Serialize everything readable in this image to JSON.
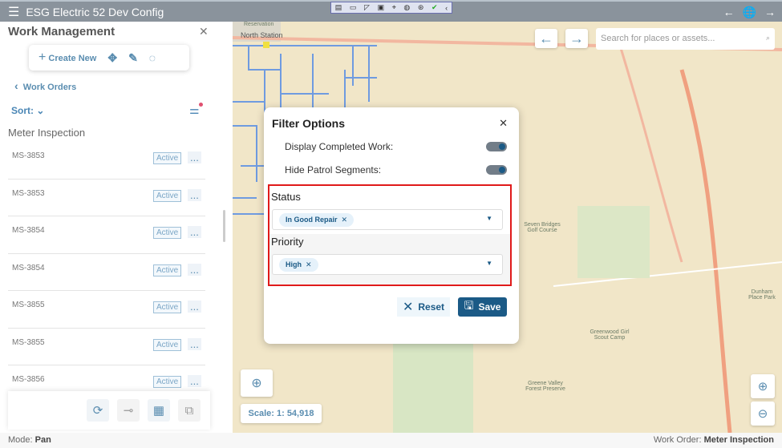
{
  "app": {
    "title": "ESG Electric 52 Dev Config",
    "menu_icon": "hamburger-icon"
  },
  "toolstrip": {
    "icons": [
      "clip-icon",
      "video-icon",
      "pointer-icon",
      "square-icon",
      "cursor-icon",
      "mic-icon",
      "accessibility-icon",
      "check-icon",
      "chevron-left-icon"
    ]
  },
  "sidebar": {
    "title": "Work Management",
    "create_new": "Create New",
    "back_label": "Work Orders",
    "sort_label": "Sort:",
    "section": "Meter Inspection",
    "items": [
      {
        "id": "MS-3853",
        "status": "Active"
      },
      {
        "id": "MS-3853",
        "status": "Active"
      },
      {
        "id": "MS-3854",
        "status": "Active"
      },
      {
        "id": "MS-3854",
        "status": "Active"
      },
      {
        "id": "MS-3855",
        "status": "Active"
      },
      {
        "id": "MS-3855",
        "status": "Active"
      },
      {
        "id": "MS-3856",
        "status": "Active"
      }
    ],
    "more": "..."
  },
  "map": {
    "search_placeholder": "Search for places or assets...",
    "scale": "Scale: 1: 54,918",
    "labels": {
      "reservation": "Reservation",
      "north_station": "North Station",
      "seven_bridges": "Seven Bridges Golf Course",
      "greenwood": "Greenwood Girl Scout Camp",
      "dunham": "Dunham Place Park",
      "greene_valley": "Greene Valley Forest Preserve"
    }
  },
  "filter": {
    "title": "Filter Options",
    "display_completed": {
      "label": "Display Completed Work:",
      "on": true
    },
    "hide_patrol": {
      "label": "Hide Patrol Segments:",
      "on": true
    },
    "status_label": "Status",
    "status_value": "In Good Repair",
    "priority_label": "Priority",
    "priority_value": "High",
    "reset": "Reset",
    "save": "Save"
  },
  "statusbar": {
    "mode_label": "Mode:",
    "mode": "Pan",
    "wo_label": "Work Order:",
    "wo": "Meter Inspection"
  },
  "colors": {
    "accent": "#1b5a86",
    "highlight": "#e01a1a",
    "topbar": "#8a939c"
  }
}
